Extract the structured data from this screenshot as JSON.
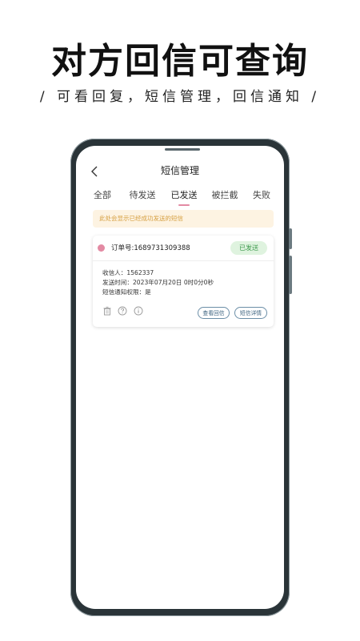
{
  "promo": {
    "headline": "对方回信可查询",
    "subline": "/ 可看回复，短信管理，回信通知 /"
  },
  "app": {
    "title": "短信管理",
    "tabs": [
      {
        "label": "全部",
        "active": false
      },
      {
        "label": "待发送",
        "active": false
      },
      {
        "label": "已发送",
        "active": true
      },
      {
        "label": "被拦截",
        "active": false
      },
      {
        "label": "失败",
        "active": false
      }
    ],
    "notice": "此处会显示已经成功发送的短信",
    "order": {
      "order_no": "订单号:1689731309388",
      "status": "已发送",
      "recipient": "收信人：1562337",
      "send_time": "发送时间：2023年07月20日 0时0分0秒",
      "notify_permission": "短信通知权限：是",
      "view_reply_label": "查看回信",
      "detail_label": "短信详情"
    }
  },
  "colors": {
    "accent": "#e38aa3",
    "status_bg": "#dff3df",
    "status_text": "#3d9a4c",
    "notice_bg": "#fdf3e2",
    "notice_text": "#d6a043",
    "button_border": "#6b8ea7"
  },
  "icons": {
    "back": "chevron-left-icon",
    "delete": "trash-icon",
    "help": "question-icon",
    "info": "info-icon"
  }
}
